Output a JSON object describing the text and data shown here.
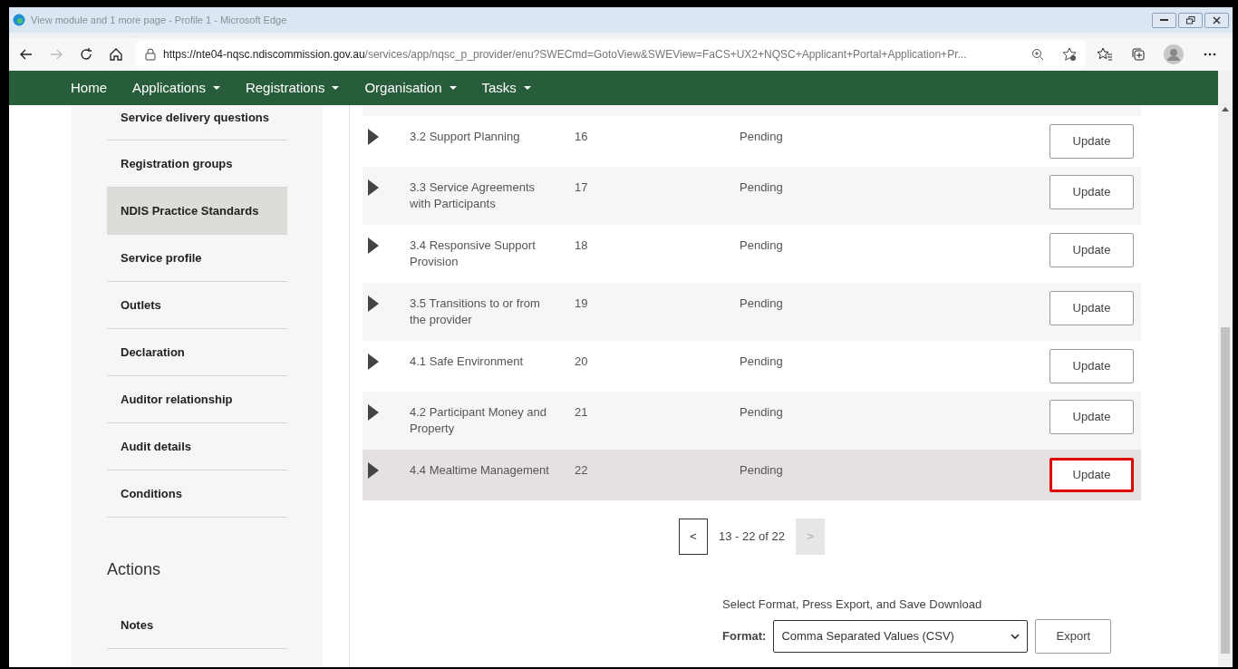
{
  "window": {
    "title": "View module and 1 more page - Profile 1 - Microsoft Edge"
  },
  "address_bar": {
    "host": "https://nte04-nqsc.ndiscommission.gov.au",
    "path": "/services/app/nqsc_p_provider/enu?SWECmd=GotoView&SWEView=FaCS+UX2+NQSC+Applicant+Portal+Application+Pr..."
  },
  "nav": [
    {
      "label": "Home",
      "dropdown": false
    },
    {
      "label": "Applications",
      "dropdown": true
    },
    {
      "label": "Registrations",
      "dropdown": true
    },
    {
      "label": "Organisation",
      "dropdown": true
    },
    {
      "label": "Tasks",
      "dropdown": true
    }
  ],
  "sidebar": {
    "items": [
      {
        "label": "Service delivery questions",
        "selected": false
      },
      {
        "label": "Registration groups",
        "selected": false
      },
      {
        "label": "NDIS Practice Standards",
        "selected": true
      },
      {
        "label": "Service profile",
        "selected": false
      },
      {
        "label": "Outlets",
        "selected": false
      },
      {
        "label": "Declaration",
        "selected": false
      },
      {
        "label": "Auditor relationship",
        "selected": false
      },
      {
        "label": "Audit details",
        "selected": false
      },
      {
        "label": "Conditions",
        "selected": false
      }
    ],
    "actions_heading": "Actions",
    "actions": [
      {
        "label": "Notes",
        "selected": false
      }
    ]
  },
  "table": {
    "rows": [
      {
        "name": "3.2 Support Planning",
        "number": "16",
        "status": "Pending",
        "button": "Update",
        "selected": false,
        "highlighted": false
      },
      {
        "name": "3.3 Service Agreements with Participants",
        "number": "17",
        "status": "Pending",
        "button": "Update",
        "selected": false,
        "highlighted": false
      },
      {
        "name": "3.4 Responsive Support Provision",
        "number": "18",
        "status": "Pending",
        "button": "Update",
        "selected": false,
        "highlighted": false
      },
      {
        "name": "3.5 Transitions to or from the provider",
        "number": "19",
        "status": "Pending",
        "button": "Update",
        "selected": false,
        "highlighted": false
      },
      {
        "name": "4.1 Safe Environment",
        "number": "20",
        "status": "Pending",
        "button": "Update",
        "selected": false,
        "highlighted": false
      },
      {
        "name": "4.2 Participant Money and Property",
        "number": "21",
        "status": "Pending",
        "button": "Update",
        "selected": false,
        "highlighted": false
      },
      {
        "name": "4.4 Mealtime Management",
        "number": "22",
        "status": "Pending",
        "button": "Update",
        "selected": true,
        "highlighted": true
      }
    ]
  },
  "pagination": {
    "prev": "<",
    "range": "13 - 22 of 22",
    "next": ">",
    "next_disabled": true
  },
  "export": {
    "instruction": "Select Format, Press Export, and Save Download",
    "format_label": "Format:",
    "format_value": "Comma Separated Values (CSV)",
    "button": "Export"
  }
}
